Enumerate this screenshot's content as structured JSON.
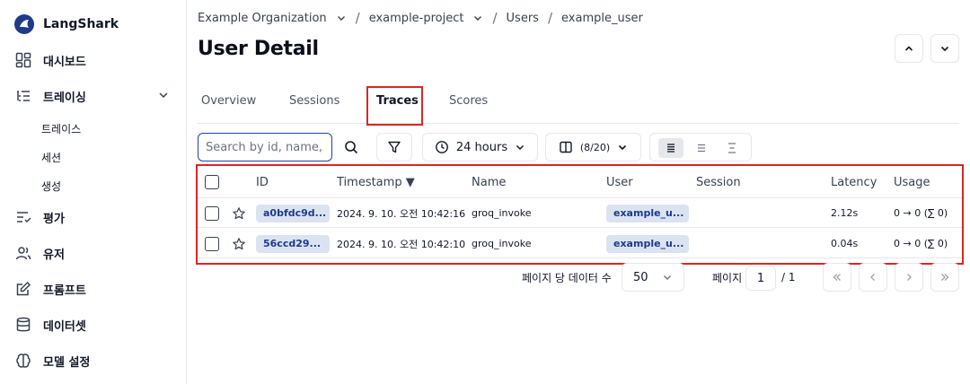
{
  "brand": {
    "name": "LangShark"
  },
  "sidebar": {
    "items": [
      {
        "label": "대시보드",
        "icon": "dashboard-icon"
      },
      {
        "label": "트레이싱",
        "icon": "tracing-icon"
      },
      {
        "label": "평가",
        "icon": "evaluation-icon"
      },
      {
        "label": "유저",
        "icon": "users-icon"
      },
      {
        "label": "프롬프트",
        "icon": "prompt-icon"
      },
      {
        "label": "데이터셋",
        "icon": "database-icon"
      },
      {
        "label": "모델 설정",
        "icon": "brain-icon"
      }
    ],
    "subitems": [
      {
        "label": "트레이스"
      },
      {
        "label": "세션"
      },
      {
        "label": "생성"
      }
    ]
  },
  "breadcrumb": {
    "org": "Example Organization",
    "project": "example-project",
    "section": "Users",
    "user": "example_user"
  },
  "page": {
    "title": "User Detail"
  },
  "tabs": [
    {
      "label": "Overview"
    },
    {
      "label": "Sessions"
    },
    {
      "label": "Traces"
    },
    {
      "label": "Scores"
    }
  ],
  "toolbar": {
    "search_placeholder": "Search by id, name, user",
    "time_range": "24 hours",
    "columns": "(8/20)"
  },
  "table": {
    "columns": [
      "ID",
      "Timestamp ▼",
      "Name",
      "User",
      "Session",
      "Latency",
      "Usage"
    ],
    "rows": [
      {
        "id": "a0bfdc9d...",
        "timestamp": "2024. 9. 10. 오전 10:42:16",
        "name": "groq_invoke",
        "user": "example_u...",
        "session": "",
        "latency": "2.12s",
        "usage": "0 → 0 (∑ 0)"
      },
      {
        "id": "56ccd29...",
        "timestamp": "2024. 9. 10. 오전 10:42:10",
        "name": "groq_invoke",
        "user": "example_u...",
        "session": "",
        "latency": "0.04s",
        "usage": "0 → 0 (∑ 0)"
      }
    ]
  },
  "pagination": {
    "rows_per_page_label": "페이지 당 데이터 수",
    "rows_per_page": "50",
    "page_label": "페이지",
    "page": "1",
    "total": "/ 1"
  },
  "colors": {
    "accent": "#1e3a8a",
    "highlight": "#dc2626",
    "pill_bg": "#dbe3f1"
  }
}
